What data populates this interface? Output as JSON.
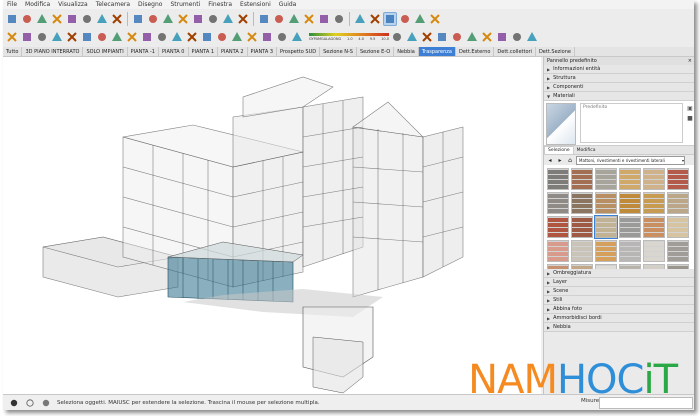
{
  "menubar": {
    "items": [
      "File",
      "Modifica",
      "Visualizza",
      "Telecamera",
      "Disegno",
      "Strumenti",
      "Finestra",
      "Estensioni",
      "Guida"
    ]
  },
  "style_ramp": {
    "labels": [
      "GYPAMGALAGONG",
      "1.0",
      "4.0",
      "9.5",
      "10.0"
    ]
  },
  "scenes": {
    "tabs": [
      "Tutto",
      "3D PIANO INTERRATO",
      "SOLO IMPIANTI",
      "PIANTA -1",
      "PIANTA 0",
      "PIANTA 1",
      "PIANTA 2",
      "PIANTA 3",
      "Prospetto SUD",
      "Sezione N-S",
      "Sezione E-O",
      "Nebbia",
      "Trasparenza",
      "Dett.Esterno",
      "Dett.collettori",
      "Dett.Sezione"
    ],
    "active": "Trasparenza"
  },
  "tray": {
    "title": "Pannello predefinito",
    "panels_top": [
      "Informazioni entità",
      "Struttura",
      "Componenti",
      "Materiali"
    ],
    "material": {
      "name_placeholder": "Predefinito",
      "tabs": [
        "Selezione",
        "Modifica"
      ],
      "active_tab": "Selezione",
      "library": "Mattoni, rivestimenti e rivestimenti laterali"
    },
    "panels_bottom": [
      "Ombreggiatura",
      "Layer",
      "Scene",
      "Stili",
      "Abbina foto",
      "Ammorbidisci bordi",
      "Nebbia"
    ]
  },
  "status": {
    "text": "Seleziona oggetti. MAIUSC per estendere la selezione. Trascina il mouse per selezione multipla.",
    "measure_label": "Misure"
  },
  "watermark": {
    "part1": "NAM",
    "part2": "HOC",
    "part3": "iT"
  },
  "icons": [
    "select-icon",
    "eraser-icon",
    "paint-bucket-icon",
    "pencil-icon",
    "line-icon",
    "arc-icon",
    "rectangle-icon",
    "push-pull-icon",
    "move-icon",
    "rotate-icon",
    "scale-icon",
    "offset-icon",
    "tape-measure-icon",
    "text-icon",
    "axes-icon",
    "orbit-icon",
    "pan-icon",
    "zoom-icon",
    "zoom-extents-icon",
    "section-plane-icon",
    "walk-icon",
    "position-camera-icon",
    "look-around-icon",
    "xray-icon",
    "wireframe-icon",
    "hidden-line-icon",
    "shaded-icon",
    "textured-icon",
    "monochrome-icon",
    "iso-view-icon",
    "top-view-icon",
    "front-view-icon",
    "right-view-icon",
    "back-view-icon",
    "left-view-icon",
    "components-icon",
    "warehouse-icon",
    "extension-icon",
    "layer-icon",
    "solid-tools-icon",
    "sandbox-icon"
  ],
  "tile_colors": [
    "#7d7c79",
    "#a46e52",
    "#a7a49b",
    "#d0a86a",
    "#cfb28a",
    "#b35a4a",
    "#8f8a86",
    "#8b7560",
    "#b88f63",
    "#bf8a3a",
    "#c89b52",
    "#bca688",
    "#b05540",
    "#9e5a44",
    "#c2b294",
    "#9a9a98",
    "#c98f60",
    "#d6c4a0",
    "#d89a8a",
    "#c9c3b8",
    "#d4a05c",
    "#b8b6b4",
    "#d9d5cf",
    "#a09c97",
    "#c79070",
    "#c2a888",
    "#e0ddd8",
    "#b7b2aa",
    "#d3cfc7",
    "#9a958d"
  ]
}
